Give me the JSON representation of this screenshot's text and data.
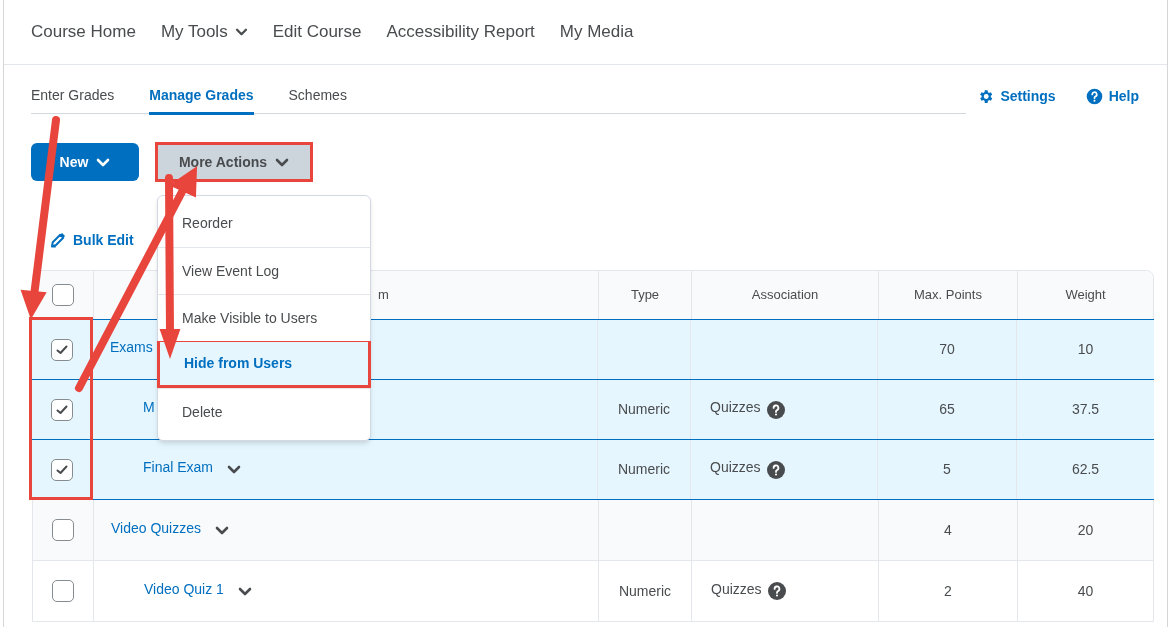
{
  "nav": {
    "items": [
      {
        "label": "Course Home",
        "dropdown": false
      },
      {
        "label": "My Tools",
        "dropdown": true
      },
      {
        "label": "Edit Course",
        "dropdown": false
      },
      {
        "label": "Accessibility Report",
        "dropdown": false
      },
      {
        "label": "My Media",
        "dropdown": false
      }
    ]
  },
  "tabs": [
    {
      "label": "Enter Grades",
      "selected": false
    },
    {
      "label": "Manage Grades",
      "selected": true
    },
    {
      "label": "Schemes",
      "selected": false
    }
  ],
  "links": [
    {
      "label": "Settings",
      "kind": "settings"
    },
    {
      "label": "Help",
      "kind": "help"
    }
  ],
  "toolbar": {
    "new_button": "New",
    "more_actions_button": "More Actions",
    "more_actions_annotated": true
  },
  "bulk_edit": "Bulk Edit",
  "menu": {
    "items": [
      {
        "label": "Reorder",
        "annotated": false
      },
      {
        "label": "View Event Log",
        "annotated": false
      },
      {
        "label": "Make Visible to Users",
        "annotated": false
      },
      {
        "label": "Hide from Users",
        "annotated": true
      },
      {
        "label": "Delete",
        "annotated": false
      }
    ]
  },
  "table": {
    "header_checked": false,
    "checkbox_column_annotated": true,
    "columns": [
      "m",
      "Type",
      "Association",
      "Max. Points",
      "Weight"
    ],
    "rows": [
      {
        "name": "Exams",
        "checked": true,
        "type": "",
        "association": "",
        "max_points": "70",
        "weight": "10",
        "children": [
          {
            "name": "M",
            "checked": true,
            "type": "Numeric",
            "association": "Quizzes",
            "max_points": "65",
            "weight": "37.5",
            "expandable": false
          },
          {
            "name": "Final Exam",
            "checked": true,
            "type": "Numeric",
            "association": "Quizzes",
            "max_points": "5",
            "weight": "62.5",
            "expandable": true
          }
        ]
      },
      {
        "name": "Video Quizzes",
        "checked": false,
        "max_points": "4",
        "weight": "20",
        "expandable": true,
        "children": [
          {
            "name": "Video Quiz 1",
            "checked": false,
            "type": "Numeric",
            "association": "Quizzes",
            "max_points": "2",
            "weight": "40",
            "expandable": true
          }
        ]
      }
    ]
  }
}
